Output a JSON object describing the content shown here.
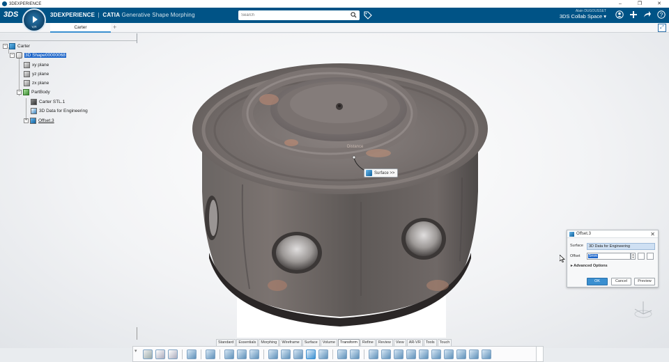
{
  "window": {
    "title": "3DEXPERIENCE",
    "controls": [
      "–",
      "❐",
      "✕"
    ]
  },
  "header": {
    "logo": "3DS",
    "brand_main": "3DEXPERIENCE",
    "brand_sep": "|",
    "brand_app": "CATIA",
    "brand_module": "Generative Shape Morphing",
    "search_placeholder": "Search",
    "user_name": "Alain DUGOUSSET",
    "collab_space": "3DS Collab Space ▾",
    "compass_label": "V,R",
    "accent_color": "#005386"
  },
  "tabs": {
    "active": "Carter",
    "add": "+"
  },
  "tree": {
    "root": "Carter",
    "selected": "3D Shape00000068",
    "planes": [
      "xy plane",
      "yz plane",
      "zx plane"
    ],
    "body": "PartBody",
    "body_children": [
      "Carter STL.1",
      "3D Data for Engineering"
    ],
    "offset": "Offset.3"
  },
  "viewport": {
    "distance_label": "Distance",
    "surface_tag": "Surface >>"
  },
  "dialog": {
    "title": "Offset.3",
    "surface_label": "Surface",
    "surface_value": "3D Data for Engineering",
    "offset_label": "Offset",
    "offset_value": "5mm",
    "advanced": "Advanced Options",
    "ok": "OK",
    "cancel": "Cancel",
    "preview": "Preview"
  },
  "action_tabs": [
    "Standard",
    "Essentials",
    "Morphing",
    "Wireframe",
    "Surface",
    "Volume",
    "Transform",
    "Refine",
    "Review",
    "View",
    "AR-VR",
    "Tools",
    "Touch"
  ],
  "action_active": "Transform"
}
